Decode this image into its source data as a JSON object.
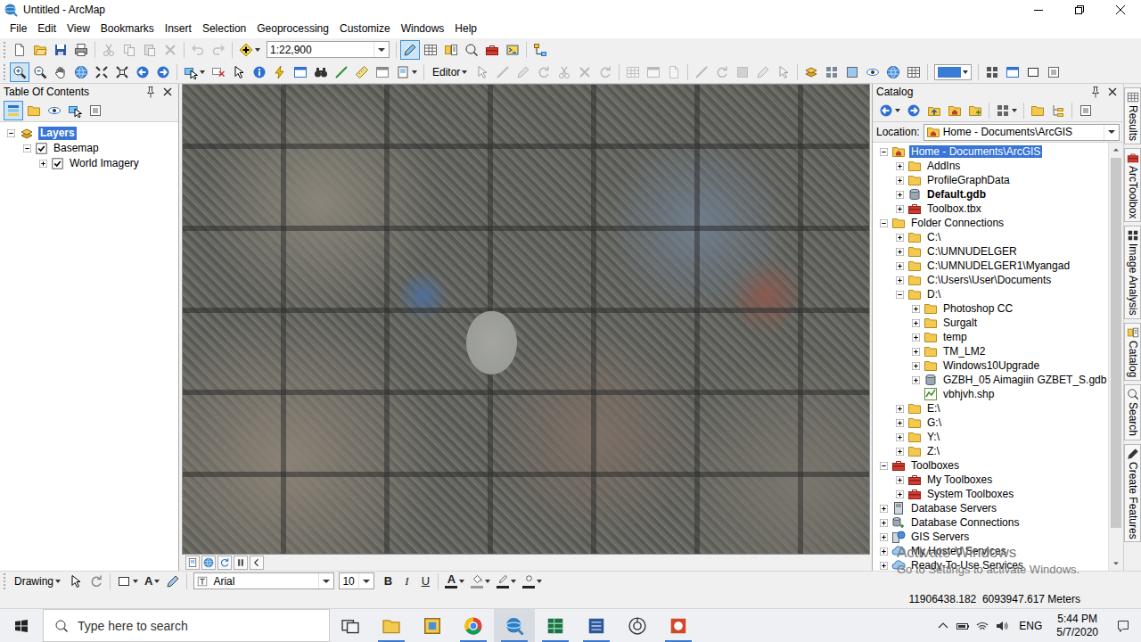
{
  "window": {
    "title": "Untitled - ArcMap"
  },
  "menu": [
    "File",
    "Edit",
    "View",
    "Bookmarks",
    "Insert",
    "Selection",
    "Geoprocessing",
    "Customize",
    "Windows",
    "Help"
  ],
  "toolbar": {
    "scale": "1:22,900",
    "editor": "Editor",
    "tools": {
      "zoom_in": {
        "selected": true
      },
      "editor_toolbar": {
        "selected": true
      },
      "edit_commands": {
        "disabled": true
      },
      "editor_tools": {
        "disabled": true
      }
    }
  },
  "toc": {
    "title": "Table Of Contents",
    "view_buttons": [
      {
        "selected": true
      },
      {
        "selected": false
      },
      {
        "selected": false
      },
      {
        "selected": false
      },
      {
        "selected": false
      }
    ],
    "tree": [
      {
        "label": "Layers",
        "kind": "data-frame",
        "expanded": true,
        "selected": true,
        "children": [
          {
            "label": "Basemap",
            "kind": "group-layer",
            "expanded": true,
            "selected": false,
            "checked": true,
            "children": [
              {
                "label": "World Imagery",
                "kind": "layer",
                "expanded": false,
                "selected": false,
                "checked": true
              }
            ]
          }
        ]
      }
    ]
  },
  "catalog": {
    "title": "Catalog",
    "location_label": "Location:",
    "location": "Home - Documents\\ArcGIS",
    "scrollbar": {
      "level": 0.93
    },
    "tree": [
      {
        "label": "Home - Documents\\ArcGIS",
        "kind": "home",
        "expanded": true,
        "selected": true,
        "children": [
          {
            "label": "AddIns",
            "kind": "folder",
            "expanded": false,
            "selected": false
          },
          {
            "label": "ProfileGraphData",
            "kind": "folder",
            "expanded": false,
            "selected": false
          },
          {
            "label": "Default.gdb",
            "kind": "default-gdb",
            "expanded": false,
            "selected": false
          },
          {
            "label": "Toolbox.tbx",
            "kind": "toolbox",
            "expanded": false,
            "selected": false
          }
        ]
      },
      {
        "label": "Folder Connections",
        "kind": "folder-connections",
        "expanded": true,
        "selected": false,
        "children": [
          {
            "label": "C:\\",
            "kind": "folder",
            "expanded": false,
            "selected": false
          },
          {
            "label": "C:\\UMNUDELGER",
            "kind": "folder",
            "expanded": false,
            "selected": false
          },
          {
            "label": "C:\\UMNUDELGER1\\Myangad",
            "kind": "folder",
            "expanded": false,
            "selected": false
          },
          {
            "label": "C:\\Users\\User\\Documents",
            "kind": "folder",
            "expanded": false,
            "selected": false
          },
          {
            "label": "D:\\",
            "kind": "folder",
            "expanded": true,
            "selected": false,
            "children": [
              {
                "label": "Photoshop CC",
                "kind": "folder",
                "expanded": false,
                "selected": false
              },
              {
                "label": "Surgalt",
                "kind": "folder",
                "expanded": false,
                "selected": false
              },
              {
                "label": "temp",
                "kind": "folder",
                "expanded": false,
                "selected": false
              },
              {
                "label": "TM_LM2",
                "kind": "folder",
                "expanded": false,
                "selected": false
              },
              {
                "label": "Windows10Upgrade",
                "kind": "folder",
                "expanded": false,
                "selected": false
              },
              {
                "label": "GZBH_05 Aimagiin GZBET_S.gdb",
                "kind": "gdb",
                "expanded": false,
                "selected": false
              },
              {
                "label": "vbhjvh.shp",
                "kind": "shapefile",
                "selected": false
              }
            ]
          },
          {
            "label": "E:\\",
            "kind": "folder",
            "expanded": false,
            "selected": false
          },
          {
            "label": "G:\\",
            "kind": "folder",
            "expanded": false,
            "selected": false
          },
          {
            "label": "Y:\\",
            "kind": "folder",
            "expanded": false,
            "selected": false
          },
          {
            "label": "Z:\\",
            "kind": "folder",
            "expanded": false,
            "selected": false
          }
        ]
      },
      {
        "label": "Toolboxes",
        "kind": "toolboxes",
        "expanded": true,
        "selected": false,
        "children": [
          {
            "label": "My Toolboxes",
            "kind": "toolbox-folder",
            "expanded": false,
            "selected": false
          },
          {
            "label": "System Toolboxes",
            "kind": "toolbox-folder",
            "expanded": false,
            "selected": false
          }
        ]
      },
      {
        "label": "Database Servers",
        "kind": "database-servers",
        "expanded": false,
        "selected": false
      },
      {
        "label": "Database Connections",
        "kind": "database-connections",
        "expanded": false,
        "selected": false
      },
      {
        "label": "GIS Servers",
        "kind": "gis-servers",
        "expanded": false,
        "selected": false
      },
      {
        "label": "My Hosted Services",
        "kind": "hosted-services",
        "expanded": false,
        "selected": false
      },
      {
        "label": "Ready-To-Use Services",
        "kind": "ready-services",
        "expanded": false,
        "selected": false
      }
    ]
  },
  "side_tabs": [
    "Results",
    "ArcToolbox",
    "Image Analysis",
    "Catalog",
    "Search",
    "Create Features"
  ],
  "drawing": {
    "menu": "Drawing",
    "new_text": "A",
    "font": "Arial",
    "size": "10",
    "bold": "B",
    "italic": "I",
    "underline": "U",
    "font_color": "A"
  },
  "status_bar": {
    "coordinates": "11906438.182  6093947.617 Meters"
  },
  "watermark": {
    "title": "Activate Windows",
    "subtitle": "Go to Settings to activate Windows."
  },
  "taskbar": {
    "search_placeholder": "Type here to search",
    "apps": [
      {
        "running": false,
        "active": false
      },
      {
        "running": true,
        "active": false
      },
      {
        "running": false,
        "active": false
      },
      {
        "running": true,
        "active": false
      },
      {
        "running": true,
        "active": true
      },
      {
        "running": true,
        "active": false
      },
      {
        "running": true,
        "active": false
      },
      {
        "running": false,
        "active": false
      },
      {
        "running": true,
        "active": false
      }
    ],
    "language": "ENG",
    "time": "5:44 PM",
    "date": "5/7/2020"
  }
}
